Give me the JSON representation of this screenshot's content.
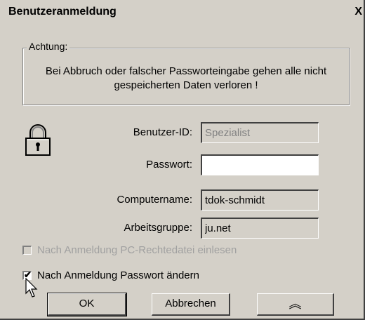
{
  "window": {
    "title": "Benutzeranmeldung",
    "close_glyph": "X"
  },
  "warning": {
    "group_label": "Achtung:",
    "line1": "Bei Abbruch oder falscher Passworteingabe gehen alle nicht",
    "line2": "gespeicherten Daten verloren !"
  },
  "fields": {
    "user_id_label": "Benutzer-ID:",
    "user_id_value": "Spezialist",
    "password_label": "Passwort:",
    "password_value": "",
    "computer_label": "Computername:",
    "computer_value": "tdok-schmidt",
    "workgroup_label": "Arbeitsgruppe:",
    "workgroup_value": "ju.net"
  },
  "options": {
    "read_rights_label": "Nach Anmeldung PC-Rechtedatei einlesen",
    "read_rights_checked": false,
    "read_rights_enabled": false,
    "change_password_label": "Nach Anmeldung Passwort ändern",
    "change_password_checked": true
  },
  "buttons": {
    "ok": "OK",
    "cancel": "Abbrechen",
    "collapse_glyph": "︽"
  },
  "icons": {
    "lock": "padlock-icon"
  }
}
